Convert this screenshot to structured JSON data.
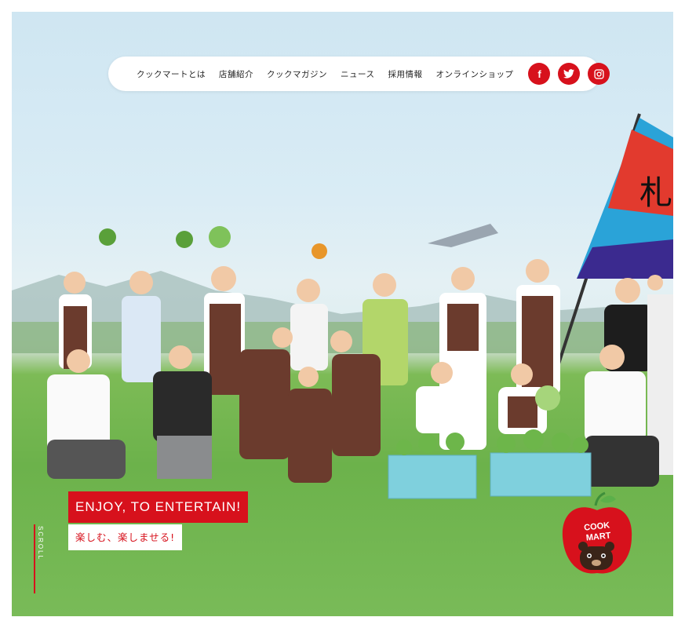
{
  "nav": {
    "links": [
      "クックマートとは",
      "店舗紹介",
      "クックマガジン",
      "ニュース",
      "採用情報",
      "オンラインショップ"
    ],
    "social": [
      {
        "name": "facebook-icon",
        "glyph": "f"
      },
      {
        "name": "twitter-icon",
        "glyph": "🐦"
      },
      {
        "name": "instagram-icon",
        "glyph": "◙"
      }
    ]
  },
  "hero": {
    "tagline_en": "ENJOY, TO ENTERTAIN!",
    "tagline_jp": "楽しむ、楽しませる!",
    "scroll_label": "SCROLL"
  },
  "logo": {
    "line1": "COOK",
    "line2": "MART"
  },
  "colors": {
    "brand_red": "#d7111c",
    "sky": "#d9ecf5",
    "grass": "#6cb24b"
  }
}
